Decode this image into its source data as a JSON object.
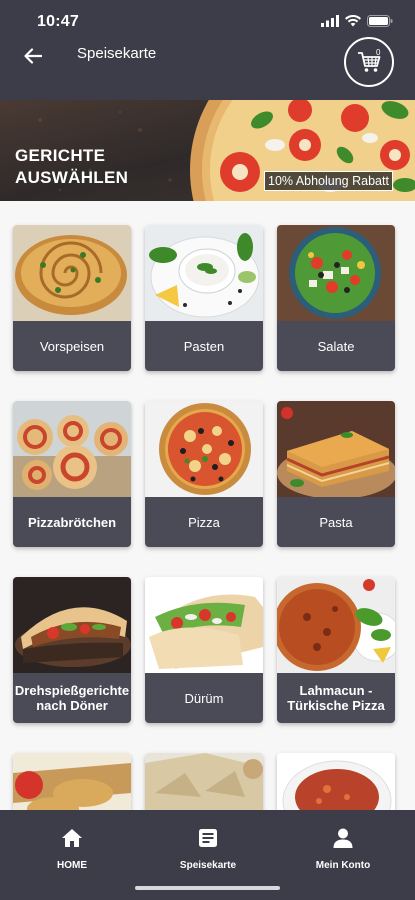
{
  "status_bar": {
    "time": "10:47"
  },
  "header": {
    "title": "Speisekarte",
    "cart_count": "0"
  },
  "banner": {
    "title_line1": "GERICHTE",
    "title_line2": "AUSWÄHLEN",
    "badge": "10% Abholung Rabatt"
  },
  "categories": [
    {
      "label": "Vorspeisen",
      "image": "spiral-pastry"
    },
    {
      "label": "Pasten",
      "image": "dip-with-herbs"
    },
    {
      "label": "Salate",
      "image": "salad-bowl"
    },
    {
      "label": "Pizzabrötchen",
      "image": "pizza-rolls"
    },
    {
      "label": "Pizza",
      "image": "pizza"
    },
    {
      "label": "Pasta",
      "image": "lasagna"
    },
    {
      "label": "Drehspießgerichte nach Döner",
      "image": "doner-plate"
    },
    {
      "label": "Dürüm",
      "image": "wrap"
    },
    {
      "label": "Lahmacun - Türkische Pizza",
      "image": "lahmacun"
    },
    {
      "label": "",
      "image": "meat-pastry"
    },
    {
      "label": "",
      "image": "flatbread"
    },
    {
      "label": "",
      "image": "soup"
    }
  ],
  "bottom_nav": {
    "home": "HOME",
    "menu": "Speisekarte",
    "account": "Mein Konto"
  }
}
